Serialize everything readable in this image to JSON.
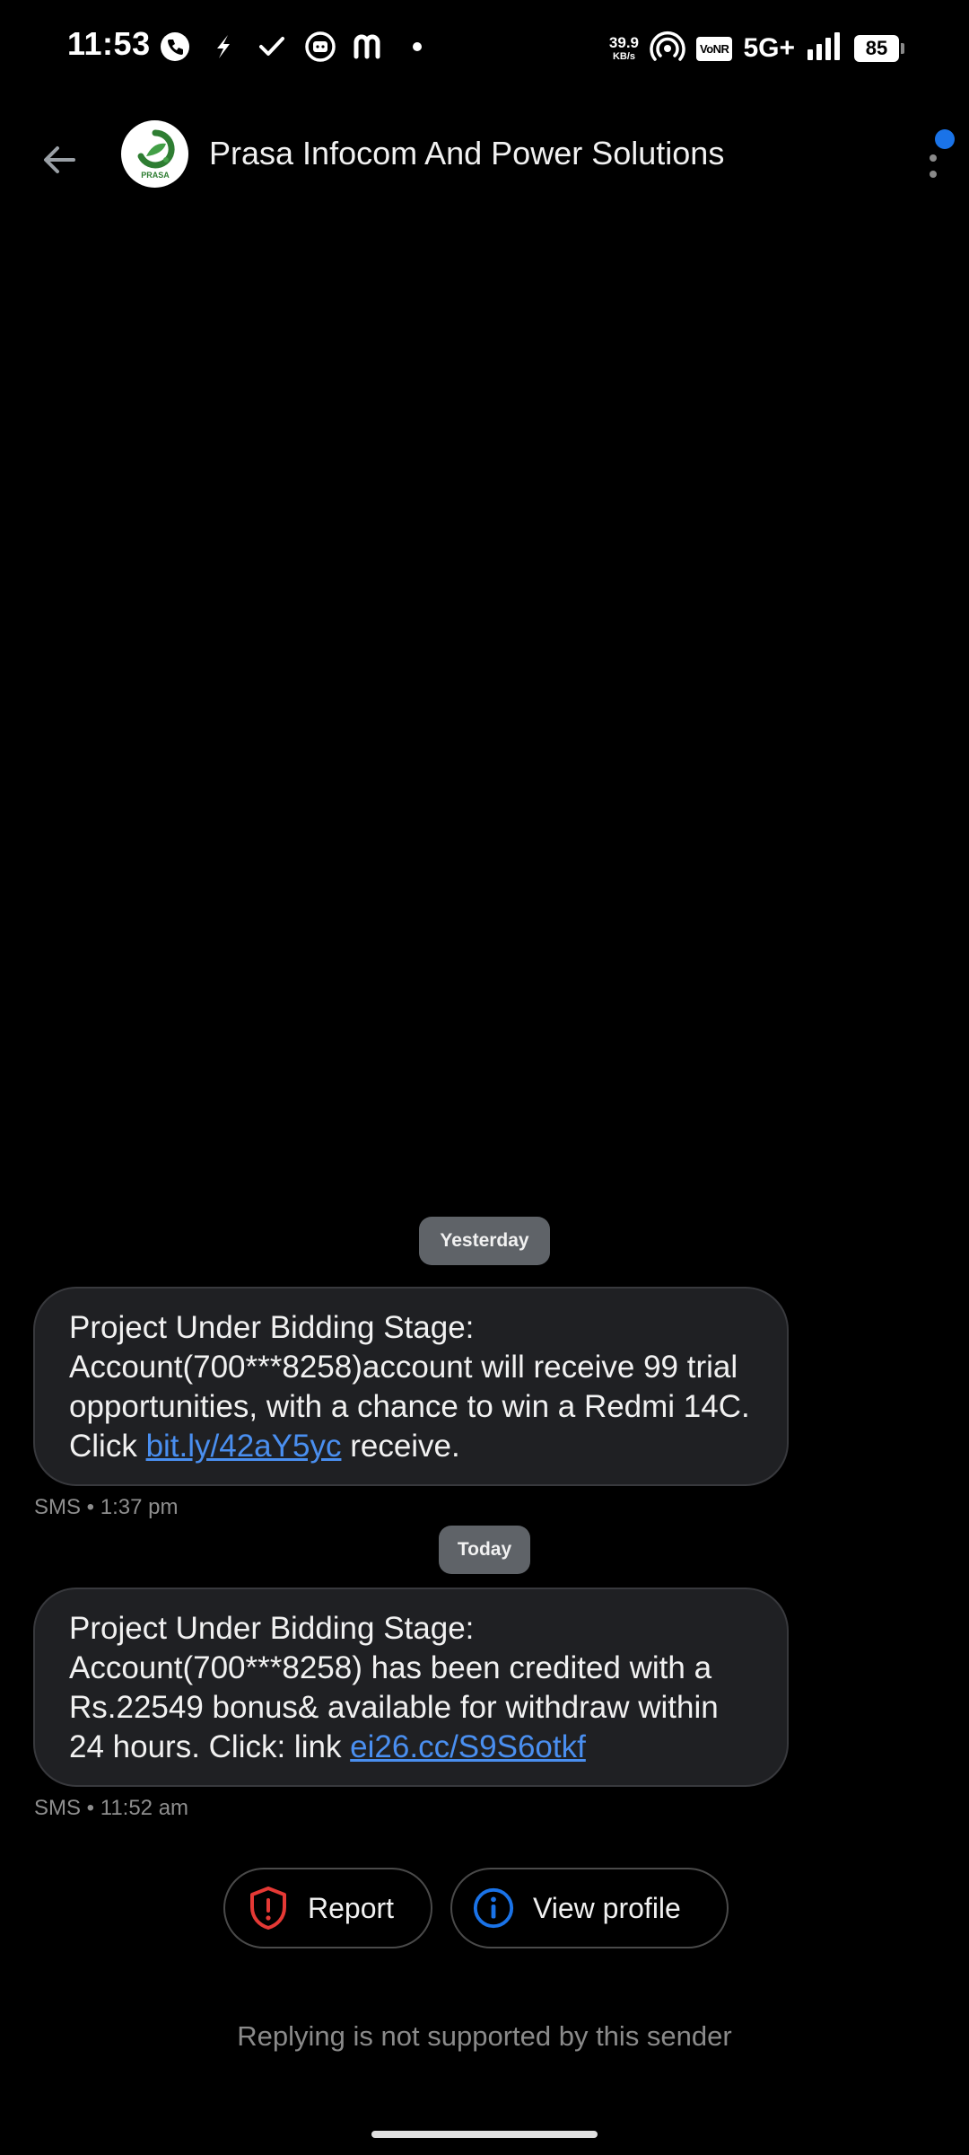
{
  "status_bar": {
    "time": "11:53",
    "net_speed_value": "39.9",
    "net_speed_unit": "KB/s",
    "vonr_label": "VoNR",
    "network_label": "5G+",
    "battery_level": "85",
    "icons": [
      "call-icon",
      "lightning-icon",
      "check-icon",
      "message-icon",
      "m-app-icon",
      "dot-icon",
      "hotspot-icon",
      "signal-icon"
    ]
  },
  "app_bar": {
    "title": "Prasa Infocom And Power Solutions",
    "avatar_text": "PRASA",
    "avatar_color": "#2e7d32"
  },
  "messages": [
    {
      "date_label": "Yesterday",
      "text_before_link": "Project Under Bidding Stage: Account(700***8258)account will receive 99 trial opportunities, with a chance to win a Redmi 14C. Click ",
      "link": "bit.ly/42aY5yc",
      "text_after_link": " receive.",
      "meta": "SMS • 1:37 pm"
    },
    {
      "date_label": "Today",
      "text_before_link": "Project Under Bidding Stage: Account(700***8258) has been credited with a Rs.22549 bonus& available for withdraw within 24 hours. Click: link ",
      "link": "ei26.cc/S9S6otkf",
      "text_after_link": "",
      "meta": "SMS • 11:52 am"
    }
  ],
  "actions": {
    "report_label": "Report",
    "view_profile_label": "View profile"
  },
  "footer": {
    "reply_note": "Replying is not supported by this sender"
  },
  "colors": {
    "link": "#4a8ff0",
    "report_icon": "#e53935",
    "info_icon": "#1a73e8",
    "notification_badge": "#1a73e8"
  }
}
